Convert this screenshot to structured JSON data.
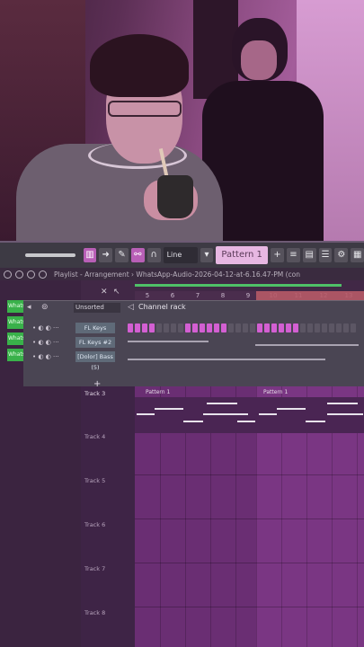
{
  "toolbar": {
    "mode_drop": "Line",
    "pattern_label": "Pattern 1"
  },
  "window": {
    "title": "Playlist - Arrangement › WhatsApp-Audio-2026-04-12-at-6.16.47-PM (con"
  },
  "browser_samples": [
    "Whats",
    "Whats",
    "Whats",
    "Whats"
  ],
  "timeline": {
    "bars": [
      "5",
      "6",
      "7",
      "8",
      "9",
      "10",
      "11",
      "12",
      "13"
    ]
  },
  "channel_rack": {
    "title": "Channel rack",
    "filter": "Unsorted",
    "channels": [
      {
        "name": "FL Keys"
      },
      {
        "name": "FL Keys #2"
      },
      {
        "name": "[Dolor] Bass (5)"
      }
    ]
  },
  "playlist": {
    "tracks": [
      "Track 3",
      "Track 4",
      "Track 5",
      "Track 6",
      "Track 7",
      "Track 8"
    ],
    "clips": [
      "Pattern 1",
      "Pattern 1"
    ]
  },
  "colors": {
    "accent": "#b85fb6",
    "step_on": "#d35fd2",
    "sample": "#39b14a"
  }
}
